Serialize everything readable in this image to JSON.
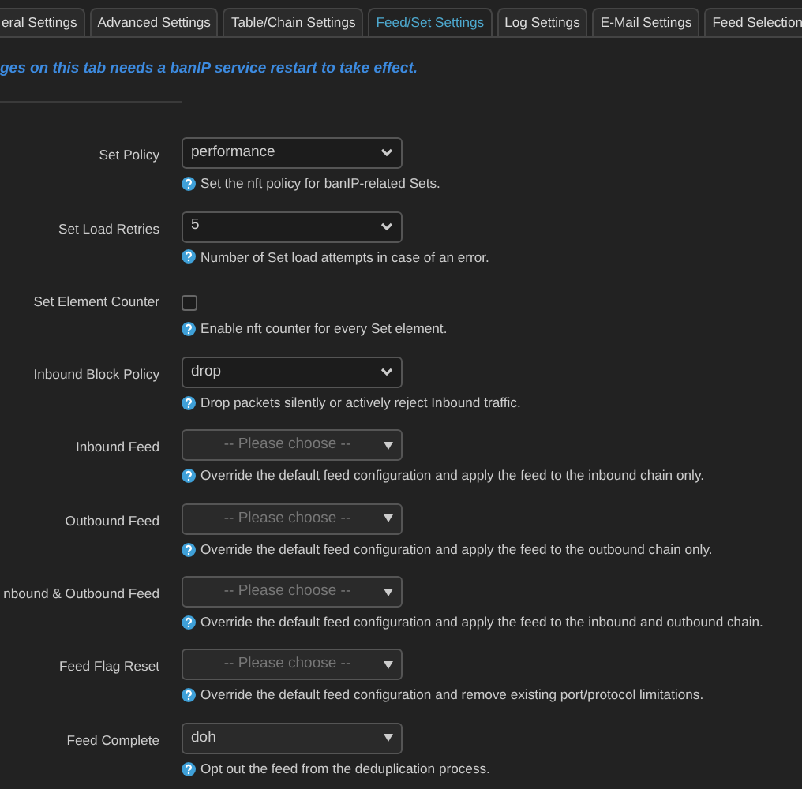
{
  "tabs": [
    {
      "label": "eral Settings",
      "selected": false
    },
    {
      "label": "Advanced Settings",
      "selected": false
    },
    {
      "label": "Table/Chain Settings",
      "selected": false
    },
    {
      "label": "Feed/Set Settings",
      "selected": true
    },
    {
      "label": "Log Settings",
      "selected": false
    },
    {
      "label": "E-Mail Settings",
      "selected": false
    },
    {
      "label": "Feed Selection",
      "selected": false
    }
  ],
  "notice": "ges on this tab needs a banIP service restart to take effect.",
  "fields": [
    {
      "label": "Set Policy",
      "kind": "select",
      "value": "performance",
      "help": "Set the nft policy for banIP-related Sets."
    },
    {
      "label": "Set Load Retries",
      "kind": "select",
      "value": "5",
      "help": "Number of Set load attempts in case of an error."
    },
    {
      "label": "Set Element Counter",
      "kind": "checkbox",
      "checked": false,
      "help": "Enable nft counter for every Set element."
    },
    {
      "label": "Inbound Block Policy",
      "kind": "select",
      "value": "drop",
      "help": "Drop packets silently or actively reject Inbound traffic."
    },
    {
      "label": "Inbound Feed",
      "kind": "dropdown",
      "placeholder": "-- Please choose --",
      "help": "Override the default feed configuration and apply the feed to the inbound chain only."
    },
    {
      "label": "Outbound Feed",
      "kind": "dropdown",
      "placeholder": "-- Please choose --",
      "help": "Override the default feed configuration and apply the feed to the outbound chain only."
    },
    {
      "label": "nbound & Outbound Feed",
      "kind": "dropdown",
      "placeholder": "-- Please choose --",
      "help": "Override the default feed configuration and apply the feed to the inbound and outbound chain."
    },
    {
      "label": "Feed Flag Reset",
      "kind": "dropdown",
      "placeholder": "-- Please choose --",
      "help": "Override the default feed configuration and remove existing port/protocol limitations."
    },
    {
      "label": "Feed Complete",
      "kind": "dropdown",
      "value": "doh",
      "help": "Opt out the feed from the deduplication process."
    }
  ]
}
